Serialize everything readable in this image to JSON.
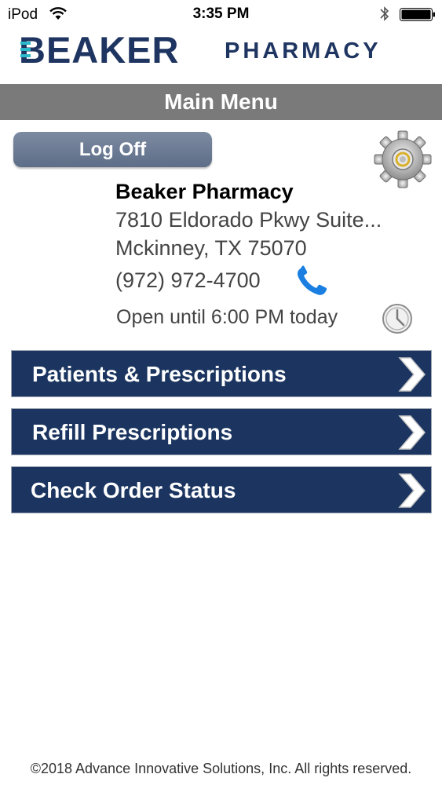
{
  "status_bar": {
    "carrier": "iPod",
    "time": "3:35 PM"
  },
  "logo": {
    "brand": "BEAKER",
    "suffix": "PHARMACY"
  },
  "header": {
    "title": "Main Menu"
  },
  "log_off_label": "Log Off",
  "pharmacy": {
    "name": "Beaker Pharmacy",
    "address_line1": "7810 Eldorado Pkwy Suite...",
    "address_line2": "Mckinney, TX 75070",
    "phone": "(972) 972-4700",
    "hours": "Open until 6:00 PM today"
  },
  "menu_items": [
    {
      "label": "Patients & Prescriptions"
    },
    {
      "label": "Refill Prescriptions"
    },
    {
      "label": "Check Order Status"
    }
  ],
  "footer": "©2018 Advance Innovative Solutions, Inc. All rights reserved.",
  "colors": {
    "brand_navy": "#1b3560",
    "header_gray": "#7a7a7a",
    "phone_blue": "#1a7fe0"
  },
  "icons": [
    "wifi-icon",
    "bluetooth-icon",
    "battery-icon",
    "gear-icon",
    "phone-icon",
    "clock-icon",
    "chevron-right-icon"
  ]
}
